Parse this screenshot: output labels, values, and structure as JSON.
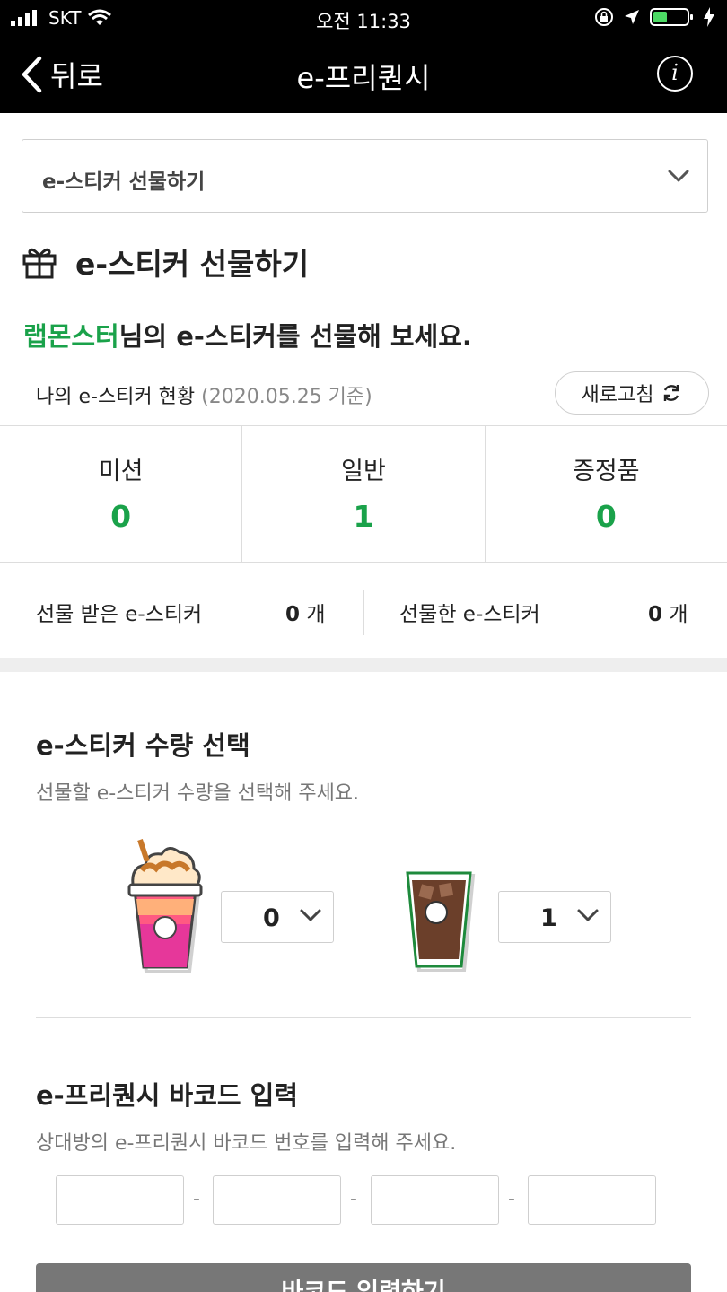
{
  "status_bar": {
    "carrier": "SKT",
    "time": "오전 11:33"
  },
  "nav": {
    "back_label": "뒤로",
    "title": "e-프리퀀시",
    "info_label": "i"
  },
  "selector": {
    "selected": "e-스티커 선물하기"
  },
  "section": {
    "title": "e-스티커 선물하기"
  },
  "greeting": {
    "name": "랩몬스터",
    "rest": "님의 e-스티커를 선물해 보세요."
  },
  "status": {
    "label": "나의 e-스티커 현황",
    "date": "(2020.05.25 기준)",
    "refresh_label": "새로고침"
  },
  "counts": [
    {
      "label": "미션",
      "value": "0"
    },
    {
      "label": "일반",
      "value": "1"
    },
    {
      "label": "증정품",
      "value": "0"
    }
  ],
  "gift": {
    "received_label": "선물 받은 e-스티커",
    "received_value": "0",
    "received_unit": "개",
    "sent_label": "선물한 e-스티커",
    "sent_value": "0",
    "sent_unit": "개"
  },
  "quantity": {
    "title": "e-스티커 수량 선택",
    "subtitle": "선물할 e-스티커 수량을 선택해 주세요.",
    "items": [
      {
        "icon": "frappuccino-icon",
        "value": "0"
      },
      {
        "icon": "iced-coffee-icon",
        "value": "1"
      }
    ]
  },
  "barcode": {
    "title": "e-프리퀀시 바코드 입력",
    "subtitle": "상대방의 e-프리퀀시 바코드 번호를 입력해 주세요.",
    "fields": [
      "",
      "",
      "",
      ""
    ],
    "separator": "-",
    "button_label": "바코드 입력하기"
  },
  "colors": {
    "accent": "#1aa24a",
    "header": "#000000",
    "button": "#777777"
  }
}
